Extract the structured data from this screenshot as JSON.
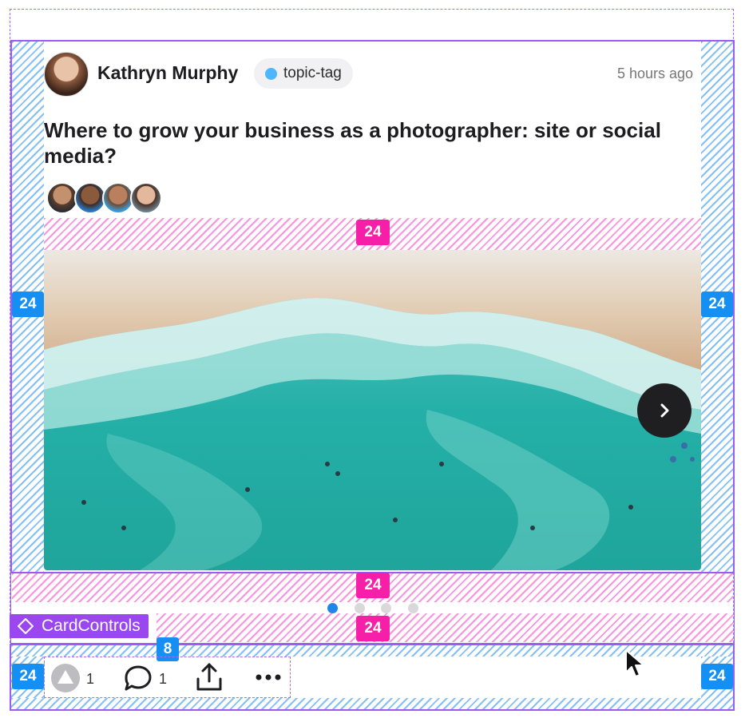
{
  "post": {
    "author_name": "Kathryn Murphy",
    "tag_label": "topic-tag",
    "timestamp": "5 hours ago",
    "title": "Where to grow your business as a photographer: site or social media?"
  },
  "spacing_labels": {
    "left": "24",
    "right": "24",
    "image_top": "24",
    "image_bottom": "24",
    "dots_bottom": "24",
    "controls_left": "24",
    "controls_right": "24",
    "controls_gap": "8"
  },
  "carousel": {
    "pages": 4,
    "active_index": 0
  },
  "component_label": "CardControls",
  "controls": {
    "upvote_count": "1",
    "comment_count": "1"
  },
  "icons": {
    "next": "chevron-right-icon",
    "upvote": "upvote-icon",
    "comment": "comment-icon",
    "share": "share-icon",
    "more": "more-icon",
    "component": "component-diamond-icon",
    "cursor": "cursor-arrow-icon"
  },
  "colors": {
    "blue_annotation": "#1590f2",
    "pink_annotation": "#f51fa8",
    "frame_purple": "#9b5cf6",
    "tag_dot": "#4cb6ff",
    "active_dot": "#1f85e6"
  }
}
